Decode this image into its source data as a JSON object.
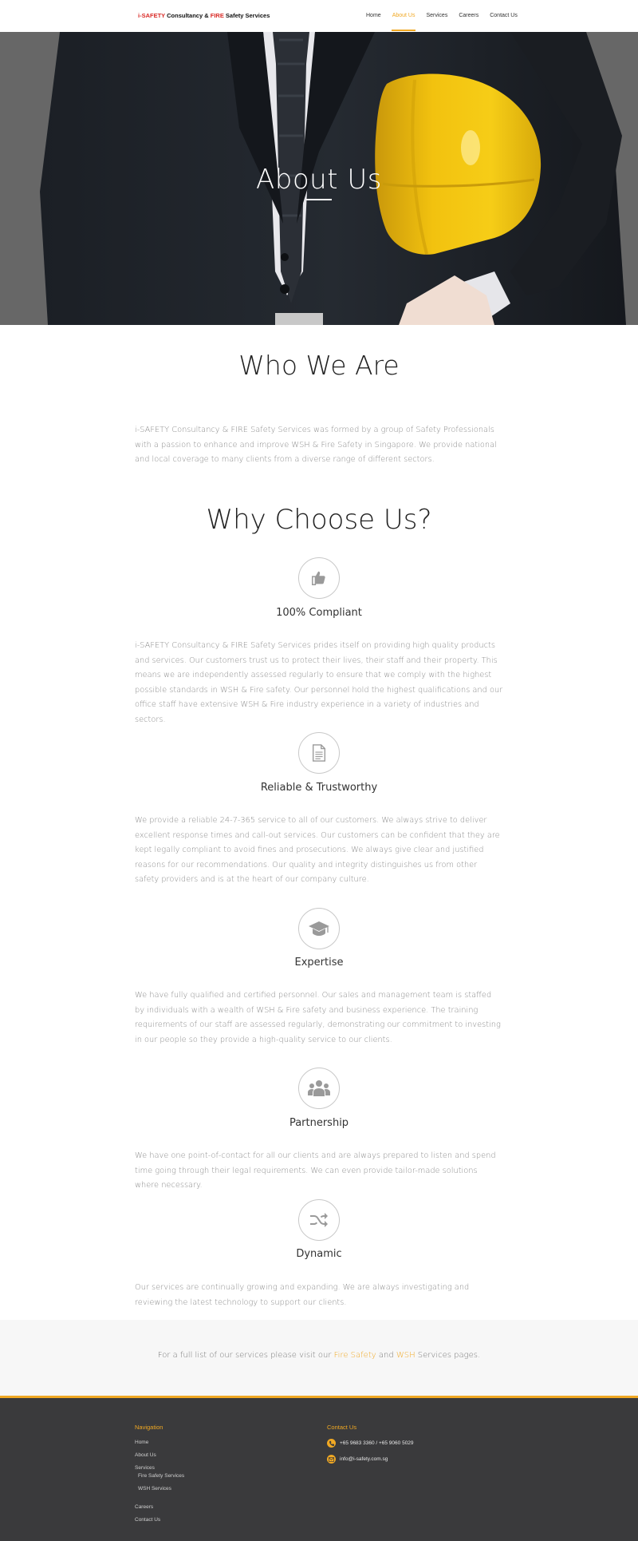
{
  "header": {
    "logo": {
      "part1": "i-SAFETY",
      "part2": " Consultancy & ",
      "part3": "FIRE",
      "part4": " Safety Services"
    },
    "nav": [
      {
        "label": "Home"
      },
      {
        "label": "About Us"
      },
      {
        "label": "Services"
      },
      {
        "label": "Careers"
      },
      {
        "label": "Contact Us"
      }
    ],
    "active_nav": "About Us"
  },
  "hero": {
    "title": "About Us"
  },
  "who": {
    "title": "Who We Are",
    "text": "i-SAFETY Consultancy & FIRE Safety Services was formed by a group of Safety Professionals with a passion to enhance and improve WSH & Fire Safety in Singapore. We provide national and local coverage to many clients from a diverse range of different sectors."
  },
  "why": {
    "title": "Why Choose Us?",
    "features": [
      {
        "icon": "thumbs-up-icon",
        "title": "100% Compliant",
        "text": "i-SAFETY Consultancy & FIRE Safety Services prides itself on providing high quality products and services. Our customers trust us to protect their lives, their staff and their property. This means we are independently assessed regularly to ensure that we comply with the highest possible standards in WSH & Fire safety. Our personnel hold the highest qualifications and our office staff have extensive WSH & Fire industry experience in a variety of industries and sectors."
      },
      {
        "icon": "document-icon",
        "title": "Reliable & Trustworthy",
        "text": "We provide a reliable 24-7-365 service to all of our customers. We always strive to deliver excellent response times and call-out services. Our customers can be confident that they are kept legally compliant to avoid fines and prosecutions. We always give clear and justified reasons for our recommendations. Our quality and integrity distinguishes us from other safety providers and is at the heart of our company culture."
      },
      {
        "icon": "graduation-cap-icon",
        "title": "Expertise",
        "text": "We have fully qualified and certified personnel. Our sales and management team is staffed by individuals with a wealth of WSH & Fire safety and business experience. The training requirements of our staff are assessed regularly, demonstrating our commitment to investing in our people so they provide a high-quality service to our clients."
      },
      {
        "icon": "group-icon",
        "title": "Partnership",
        "text": "We have one point-of-contact for all our clients and are always prepared to listen and spend time going through their legal requirements. We can even provide tailor-made solutions where necessary."
      },
      {
        "icon": "shuffle-icon",
        "title": "Dynamic",
        "text": "Our services are continually growing and expanding. We are always investigating and reviewing the latest technology to support our clients."
      }
    ]
  },
  "cta": {
    "before": "For a full list of our services please visit our ",
    "link1": "Fire Safety",
    "middle": " and ",
    "link2": "WSH",
    "after": " Services pages."
  },
  "footer": {
    "nav_heading": "Navigation",
    "nav_links": [
      {
        "label": "Home"
      },
      {
        "label": "About Us"
      },
      {
        "label": "Services"
      },
      {
        "label": "Fire Safety Services"
      },
      {
        "label": "WSH Services"
      },
      {
        "label": "Careers"
      },
      {
        "label": "Contact Us"
      }
    ],
    "contact_heading": "Contact Us",
    "phone": "+65 9683 3360 / +65 9060 5029",
    "email": "info@i-safety.com.sg"
  },
  "colors": {
    "accent": "#f0a823",
    "brand_red": "#d92b27",
    "footer_bg": "#3a3a3c"
  }
}
